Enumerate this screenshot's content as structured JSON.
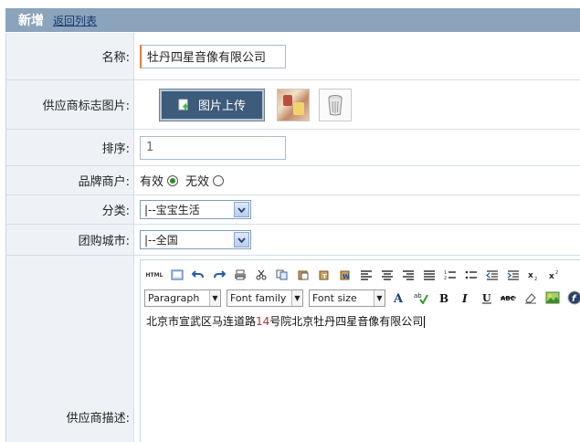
{
  "header": {
    "title": "新增",
    "back_link": "返回列表"
  },
  "form": {
    "name": {
      "label": "名称:",
      "value": "牡丹四星音像有限公司"
    },
    "logo": {
      "label": "供应商标志图片:",
      "upload_label": "图片上传"
    },
    "order": {
      "label": "排序:",
      "value": "1"
    },
    "brand": {
      "label": "品牌商户:",
      "options": [
        "有效",
        "无效"
      ],
      "selected": "有效"
    },
    "category": {
      "label": "分类:",
      "selected": "|--宝宝生活"
    },
    "city": {
      "label": "团购城市:",
      "selected": "|--全国"
    },
    "description": {
      "label": "供应商描述:",
      "editor": {
        "format_select": "Paragraph",
        "font_family_select": "Font family",
        "font_size_select": "Font size",
        "html_button": "HTML",
        "content_before": "北京市宣武区马连道路",
        "content_number": "14",
        "content_after": "号院北京牡丹四星音像有限公司"
      }
    }
  },
  "colors": {
    "header_bg": "#8ba4bc",
    "label_bg": "#eef2f6",
    "upload_btn_bg": "#3d5b7b"
  }
}
